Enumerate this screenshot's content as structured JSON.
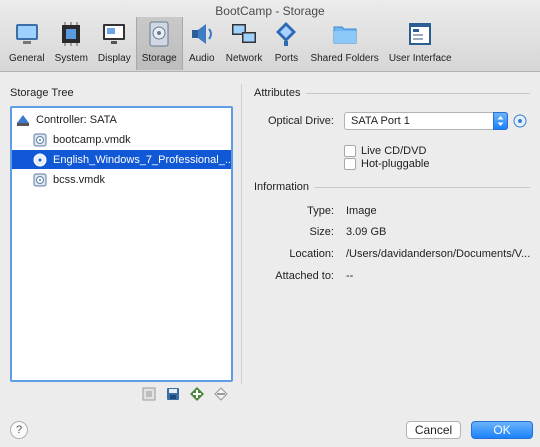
{
  "window": {
    "title": "BootCamp - Storage"
  },
  "toolbar": {
    "items": [
      {
        "label": "General",
        "icon": "general-icon"
      },
      {
        "label": "System",
        "icon": "chip-icon"
      },
      {
        "label": "Display",
        "icon": "display-icon"
      },
      {
        "label": "Storage",
        "icon": "storage-icon",
        "active": true
      },
      {
        "label": "Audio",
        "icon": "speaker-icon"
      },
      {
        "label": "Network",
        "icon": "network-icon"
      },
      {
        "label": "Ports",
        "icon": "ports-icon"
      },
      {
        "label": "Shared Folders",
        "icon": "folder-icon"
      },
      {
        "label": "User Interface",
        "icon": "user-interface-icon"
      }
    ]
  },
  "storage_tree": {
    "title": "Storage Tree",
    "controller": "Controller: SATA",
    "items": [
      {
        "label": "bootcamp.vmdk",
        "icon": "hard-disk-icon"
      },
      {
        "label": "English_Windows_7_Professional_...",
        "icon": "optical-disc-icon",
        "selected": true
      },
      {
        "label": "bcss.vmdk",
        "icon": "hard-disk-icon"
      }
    ]
  },
  "attributes": {
    "title": "Attributes",
    "optical_drive_label": "Optical Drive:",
    "optical_drive_value": "SATA Port 1",
    "live_cd_label": "Live CD/DVD",
    "live_cd_checked": false,
    "hot_pluggable_label": "Hot-pluggable",
    "hot_pluggable_checked": false
  },
  "information": {
    "title": "Information",
    "type_label": "Type:",
    "type_value": "Image",
    "size_label": "Size:",
    "size_value": "3.09 GB",
    "location_label": "Location:",
    "location_value": "/Users/davidanderson/Documents/V...",
    "attached_label": "Attached to:",
    "attached_value": "--"
  },
  "footer": {
    "help": "?",
    "cancel": "Cancel",
    "ok": "OK"
  },
  "colors": {
    "selection": "#1058d6",
    "accent_blue": "#1a82fb",
    "tree_border": "#5e9de6"
  }
}
